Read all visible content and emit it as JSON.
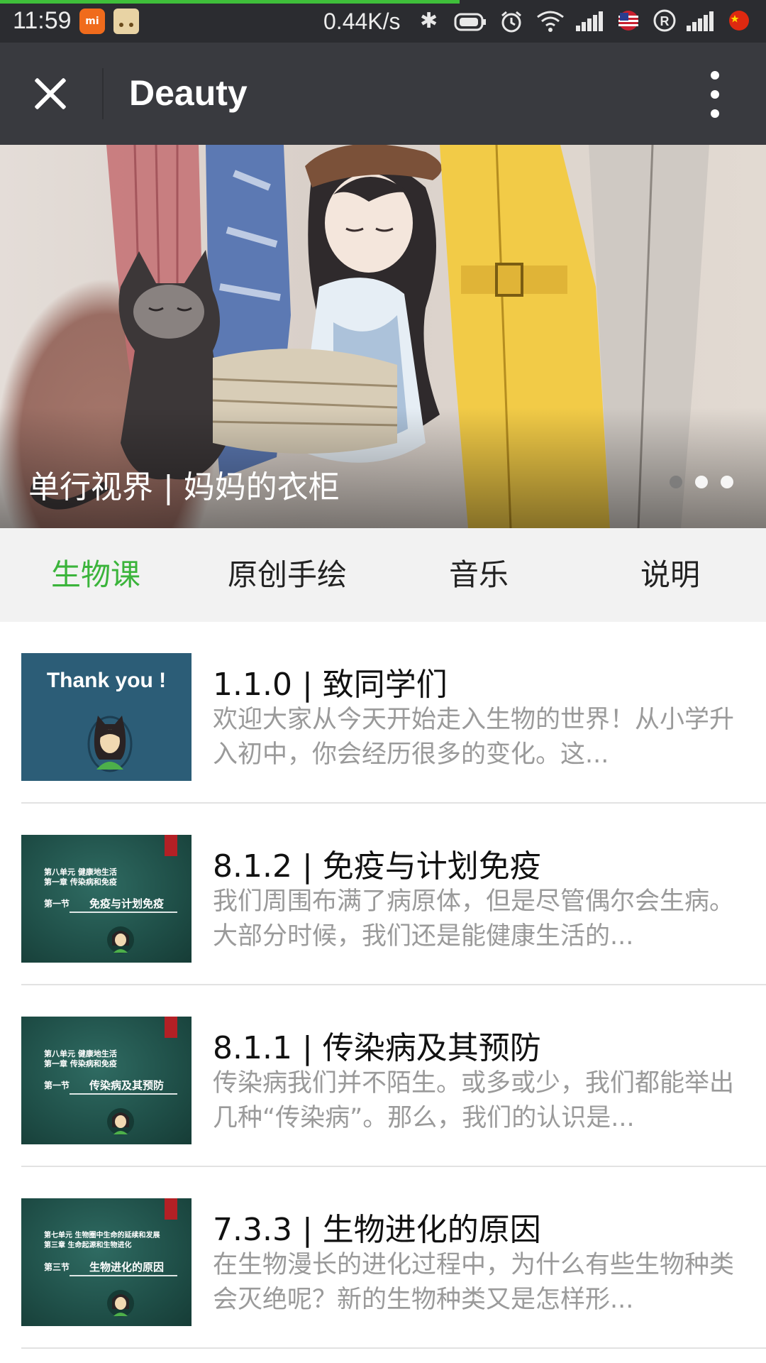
{
  "status_bar": {
    "time": "11:59",
    "mi_label": "mi",
    "network_speed": "0.44K/s",
    "roaming_label": "R",
    "page_load_progress": 0.6
  },
  "header": {
    "title": "Deauty"
  },
  "banner": {
    "caption": "单行视界 | 妈妈的衣柜",
    "slide_count": 3,
    "active_slide": 1
  },
  "tabs": [
    {
      "label": "生物课",
      "active": true
    },
    {
      "label": "原创手绘",
      "active": false
    },
    {
      "label": "音乐",
      "active": false
    },
    {
      "label": "说明",
      "active": false
    }
  ],
  "articles": [
    {
      "title": "1.1.0 | 致同学们",
      "description": "欢迎大家从今天开始走入生物的世界！从小学升入初中，你会经历很多的变化。这...",
      "thumb": {
        "style": "blue",
        "text": "Thank you !"
      }
    },
    {
      "title": "8.1.2 | 免疫与计划免疫",
      "description": "我们周围布满了病原体，但是尽管偶尔会生病。大部分时候，我们还是能健康生活的...",
      "thumb": {
        "style": "green",
        "unit": "第八单元  健康地生活",
        "chapter": "第一章  传染病和免疫",
        "section": "第一节",
        "section_title": "免疫与计划免疫"
      }
    },
    {
      "title": "8.1.1 | 传染病及其预防",
      "description": "传染病我们并不陌生。或多或少，我们都能举出几种“传染病”。那么，我们的认识是...",
      "thumb": {
        "style": "green",
        "unit": "第八单元  健康地生活",
        "chapter": "第一章  传染病和免疫",
        "section": "第一节",
        "section_title": "传染病及其预防"
      }
    },
    {
      "title": "7.3.3 | 生物进化的原因",
      "description": "在生物漫长的进化过程中，为什么有些生物种类会灭绝呢？新的生物种类又是怎样形...",
      "thumb": {
        "style": "green",
        "unit": "第七单元  生物圈中生命的延续和发展",
        "chapter": "第三章  生命起源和生物进化",
        "section": "第三节",
        "section_title": "生物进化的原因"
      }
    }
  ],
  "colors": {
    "accent_green": "#3bb43b",
    "header_bg": "#393a3f",
    "statusbar_bg": "#2b2c30"
  }
}
